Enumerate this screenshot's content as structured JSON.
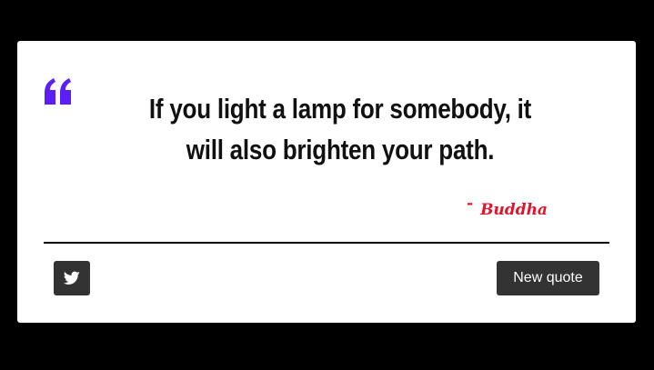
{
  "quote": {
    "text": "If you light a lamp for somebody, it will also brighten your path.",
    "author_dash": "-",
    "author": "Buddha",
    "quote_icon": "left-quote-icon",
    "quote_icon_color": "#5b1ff5",
    "author_color": "#e0142a"
  },
  "actions": {
    "tweet_icon": "twitter-icon",
    "new_quote_label": "New quote"
  },
  "colors": {
    "background": "#000000",
    "card": "#ffffff",
    "button": "#333333"
  }
}
